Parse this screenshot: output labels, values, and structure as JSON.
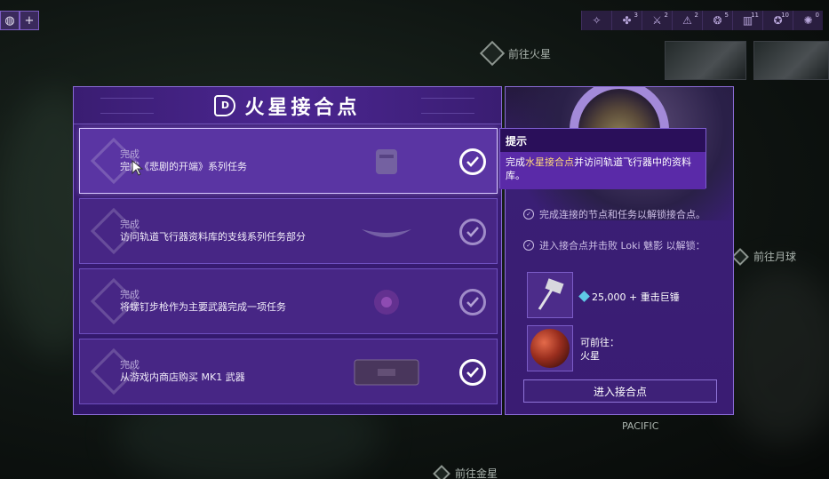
{
  "top_left_buttons": [
    {
      "icon": "globe-icon",
      "glyph": "◍"
    },
    {
      "icon": "plus-icon",
      "glyph": "+"
    }
  ],
  "top_stats": [
    {
      "icon": "warframe-icon",
      "glyph": "✧",
      "count": ""
    },
    {
      "icon": "flower-icon",
      "glyph": "✤",
      "count": "3"
    },
    {
      "icon": "swords-icon",
      "glyph": "⚔",
      "count": "2"
    },
    {
      "icon": "warning-icon",
      "glyph": "⚠",
      "count": "2"
    },
    {
      "icon": "spiral-icon",
      "glyph": "❂",
      "count": "5"
    },
    {
      "icon": "bars-icon",
      "glyph": "▥",
      "count": "11"
    },
    {
      "icon": "star-icon",
      "glyph": "✪",
      "count": "10"
    },
    {
      "icon": "cluster-icon",
      "glyph": "✺",
      "count": "0"
    }
  ],
  "map": {
    "node_mars": "前往火星",
    "node_moon": "前往月球",
    "node_venus": "前往金星",
    "pacific": "PACIFIC"
  },
  "panel": {
    "title": "火星接合点",
    "tasks": [
      {
        "status": "完成",
        "desc": "完成《悲剧的开端》系列任务",
        "item_icon": "chest-armor-icon"
      },
      {
        "status": "完成",
        "desc": "访问轨道飞行器资料库的支线系列任务部分",
        "item_icon": "syandana-icon"
      },
      {
        "status": "完成",
        "desc": "将螺钉步枪作为主要武器完成一项任务",
        "item_icon": "emblem-icon"
      },
      {
        "status": "完成",
        "desc": "从游戏内商店购买 MK1 武器",
        "item_icon": "weapon-case-icon"
      }
    ]
  },
  "tooltip": {
    "title": "提示",
    "body_prefix": "完成",
    "body_highlight": "水星接合点",
    "body_suffix": "并访问轨道飞行器中的资料库。"
  },
  "right": {
    "requirements": [
      "完成连接的节点和任务以解锁接合点。",
      "进入接合点并击败 Loki 魅影 以解锁："
    ],
    "reward_text": "25,000 + 重击巨锤",
    "destination_label": "可前往：",
    "destination_value": "火星",
    "enter_button": "进入接合点"
  },
  "colors": {
    "panel_purple": "#3e1f7a",
    "tooltip_highlight": "#ffd97a",
    "credit_gem": "#5fc9e6"
  }
}
